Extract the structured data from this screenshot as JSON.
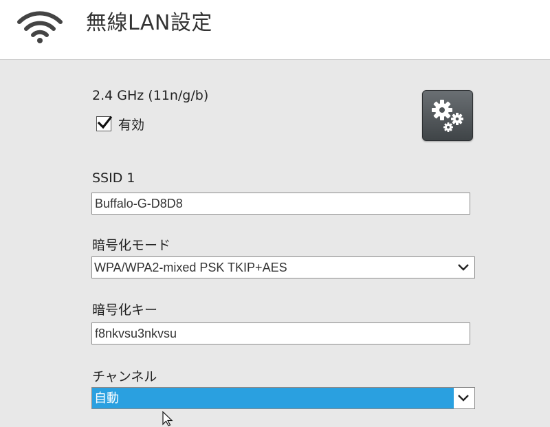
{
  "header": {
    "title": "無線LAN設定",
    "icon": "wifi-icon"
  },
  "band": {
    "label": "2.4 GHz (11n/g/b)",
    "enable_label": "有効",
    "enabled": true,
    "settings_icon": "gears-icon"
  },
  "ssid": {
    "label": "SSID 1",
    "value": "Buffalo-G-D8D8"
  },
  "encryption_mode": {
    "label": "暗号化モード",
    "selected": "WPA/WPA2-mixed PSK TKIP+AES"
  },
  "encryption_key": {
    "label": "暗号化キー",
    "value": "f8nkvsu3nkvsu"
  },
  "channel": {
    "label": "チャンネル",
    "selected": "自動"
  },
  "colors": {
    "accent": "#2aa0e0",
    "background": "#e8e8e8",
    "header": "#ffffff",
    "button": "#4f5457"
  }
}
